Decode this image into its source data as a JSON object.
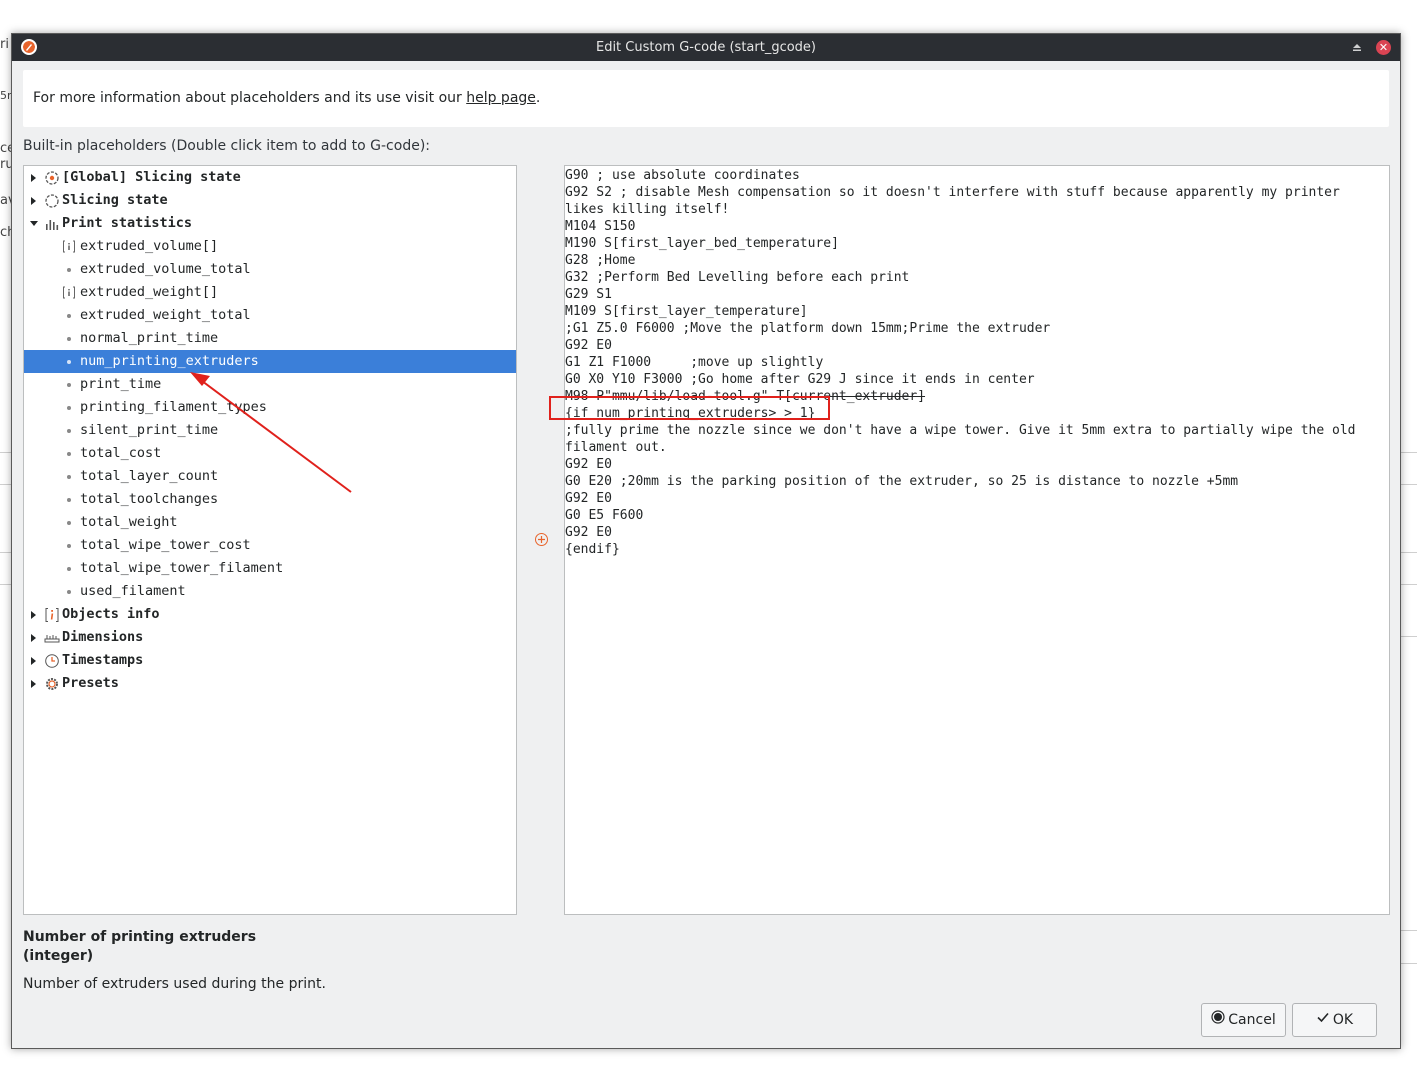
{
  "background": {
    "fragments": [
      "ri",
      "5m",
      "ce",
      "ru",
      "av",
      "ch"
    ]
  },
  "dialog": {
    "title": "Edit Custom G-code (start_gcode)",
    "info": {
      "prefix": "For more information about placeholders and its use visit our ",
      "link": "help page",
      "suffix": "."
    },
    "placeholders_label": "Built-in placeholders (Double click item to add to G-code):",
    "tree": {
      "groups": [
        {
          "label": "[Global] Slicing state",
          "icon": "global-slicing-icon",
          "expanded": false
        },
        {
          "label": "Slicing state",
          "icon": "slicing-state-icon",
          "expanded": false
        },
        {
          "label": "Print statistics",
          "icon": "statistics-icon",
          "expanded": true
        },
        {
          "label": "Objects info",
          "icon": "info-icon",
          "expanded": false
        },
        {
          "label": "Dimensions",
          "icon": "ruler-icon",
          "expanded": false
        },
        {
          "label": "Timestamps",
          "icon": "clock-icon",
          "expanded": false
        },
        {
          "label": "Presets",
          "icon": "gear-icon",
          "expanded": false
        }
      ],
      "print_statistics_items": [
        {
          "label": "extruded_volume[]",
          "type": "vector"
        },
        {
          "label": "extruded_volume_total",
          "type": "scalar"
        },
        {
          "label": "extruded_weight[]",
          "type": "vector"
        },
        {
          "label": "extruded_weight_total",
          "type": "scalar"
        },
        {
          "label": "normal_print_time",
          "type": "scalar"
        },
        {
          "label": "num_printing_extruders",
          "type": "scalar",
          "selected": true
        },
        {
          "label": "print_time",
          "type": "scalar"
        },
        {
          "label": "printing_filament_types",
          "type": "scalar"
        },
        {
          "label": "silent_print_time",
          "type": "scalar"
        },
        {
          "label": "total_cost",
          "type": "scalar"
        },
        {
          "label": "total_layer_count",
          "type": "scalar"
        },
        {
          "label": "total_toolchanges",
          "type": "scalar"
        },
        {
          "label": "total_weight",
          "type": "scalar"
        },
        {
          "label": "total_wipe_tower_cost",
          "type": "scalar"
        },
        {
          "label": "total_wipe_tower_filament",
          "type": "scalar"
        },
        {
          "label": "used_filament",
          "type": "scalar"
        }
      ]
    },
    "gcode_lines": [
      "G90 ; use absolute coordinates",
      "G92 S2 ; disable Mesh compensation so it doesn't interfere with stuff because apparently my printer",
      "likes killing itself!",
      "M104 S150",
      "M190 S[first_layer_bed_temperature]",
      "G28 ;Home",
      "G32 ;Perform Bed Levelling before each print",
      "G29 S1",
      "M109 S[first_layer_temperature]",
      ";G1 Z5.0 F6000 ;Move the platform down 15mm;Prime the extruder",
      "G92 E0",
      "G1 Z1 F1000     ;move up slightly",
      "G0 X0 Y10 F3000 ;Go home after G29 J since it ends in center",
      "M98 P\"mmu/lib/load-tool.g\" T[current_extruder]",
      "{if num_printing_extruders> > 1}",
      ";fully prime the nozzle since we don't have a wipe tower. Give it 5mm extra to partially wipe the old",
      "filament out.",
      "G92 E0",
      "G0 E20 ;20mm is the parking position of the extruder, so 25 is distance to nozzle +5mm",
      "G92 E0",
      "G0 E5 F600",
      "G92 E0",
      "{endif}"
    ],
    "description": {
      "title_line1": "Number of printing extruders",
      "title_line2": "(integer)",
      "body": "Number of extruders used during the print."
    },
    "buttons": {
      "cancel": "Cancel",
      "ok": "OK"
    }
  },
  "colors": {
    "selection": "#3b7fd9",
    "annotation": "#e0211c",
    "titlebar": "#2b2e33",
    "close": "#da4453",
    "icon_accent": "#e8642c"
  }
}
